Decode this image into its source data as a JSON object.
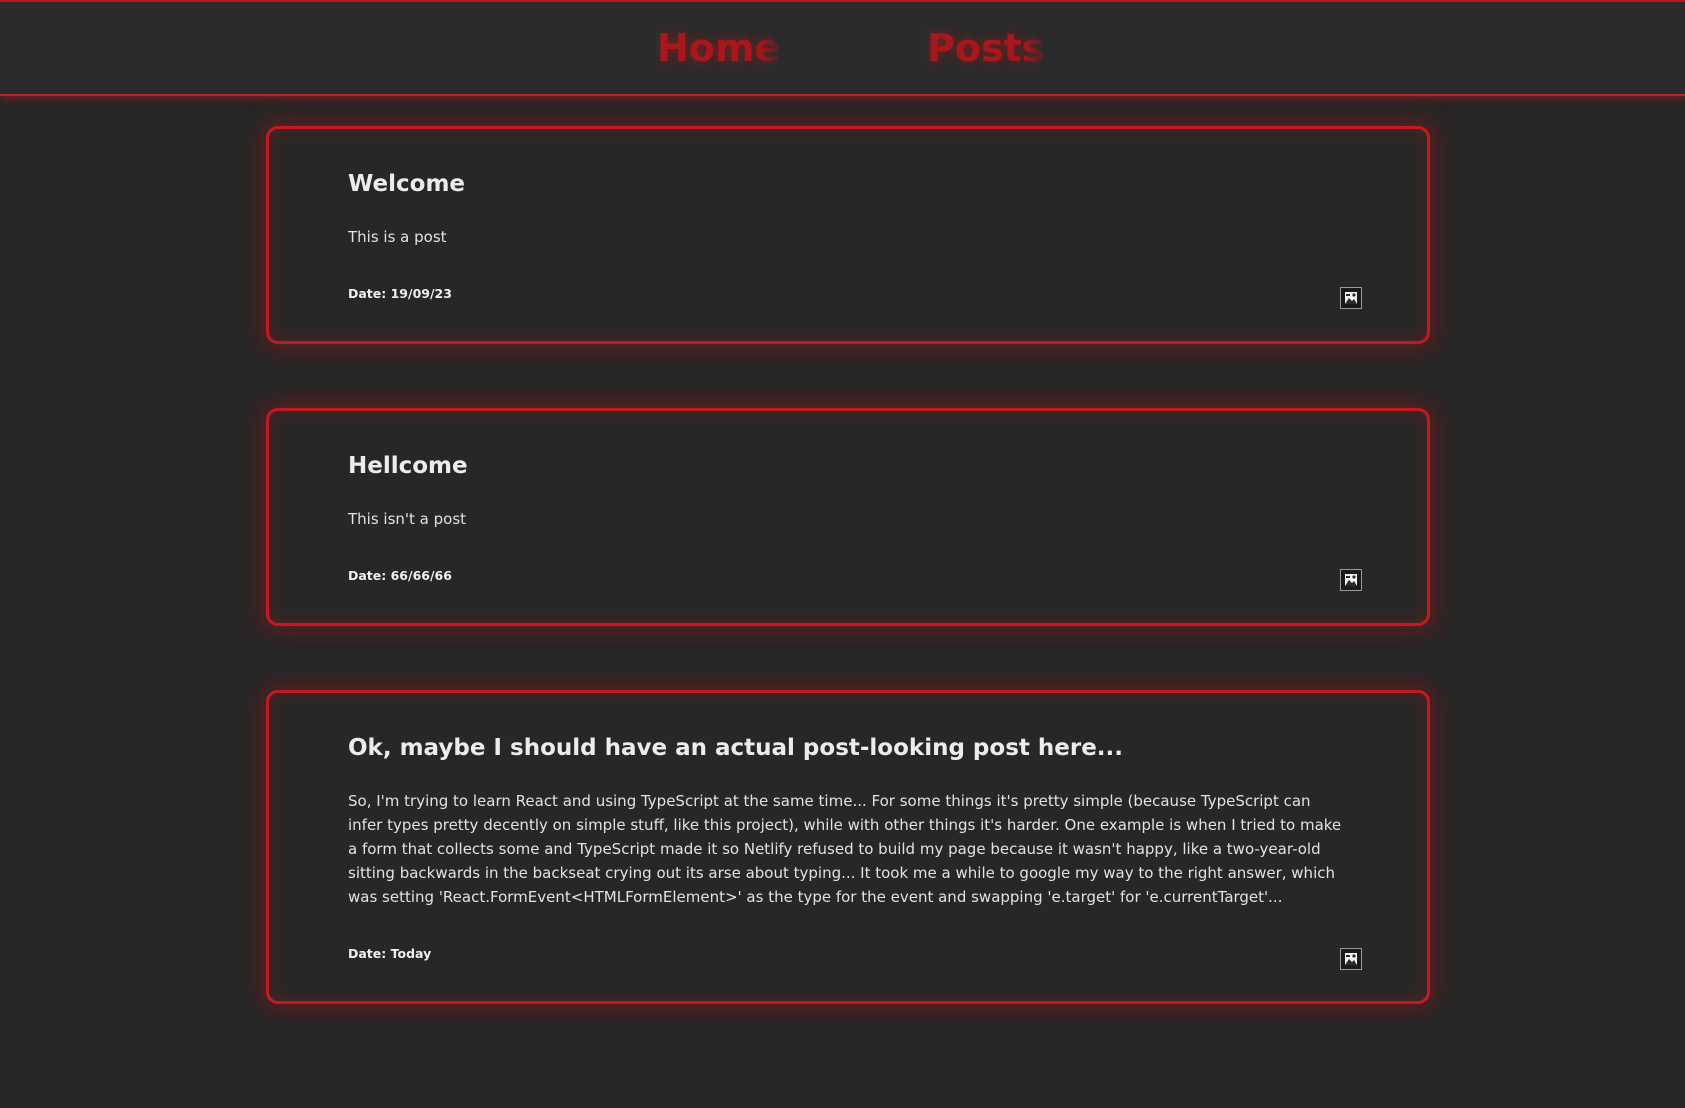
{
  "nav": {
    "home_label": "Home",
    "posts_label": "Posts"
  },
  "posts": [
    {
      "title": "Welcome",
      "body": "This is a post",
      "date": "Date: 19/09/23",
      "icon": "broken-image-icon"
    },
    {
      "title": "Hellcome",
      "body": "This isn't a post",
      "date": "Date: 66/66/66",
      "icon": "broken-image-icon"
    },
    {
      "title": "Ok, maybe I should have an actual post-looking post here...",
      "body": "So, I'm trying to learn React and using TypeScript at the same time... For some things it's pretty simple (because TypeScript can infer types pretty decently on simple stuff, like this project), while with other things it's harder. One example is when I tried to make a form that collects some and TypeScript made it so Netlify refused to build my page because it wasn't happy, like a two-year-old sitting backwards in the backseat crying out its arse about typing... It took me a while to google my way to the right answer, which was setting 'React.FormEvent<HTMLFormElement>' as the type for the event and swapping 'e.target' for 'e.currentTarget'...",
      "date": "Date: Today",
      "icon": "broken-image-icon"
    }
  ],
  "colors": {
    "background": "#262626",
    "accent": "#c11c22",
    "nav_text": "#a8171b",
    "text": "#e9e9e9"
  }
}
